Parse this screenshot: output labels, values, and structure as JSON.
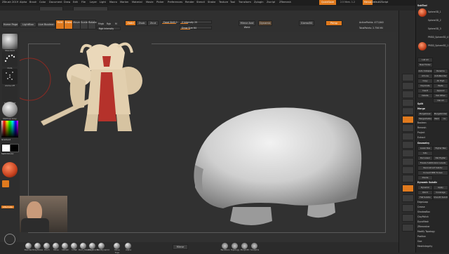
{
  "title": "ZBrush 2019",
  "menu_top": [
    "Alpha",
    "Brush",
    "Color",
    "Document",
    "Draw",
    "Edit",
    "File",
    "Layer",
    "Light",
    "Macro",
    "Marker",
    "Material",
    "Movie",
    "Picker",
    "Preferences",
    "Render",
    "Stencil",
    "Stroke",
    "Texture",
    "Tool",
    "Transform",
    "Zplugin",
    "Zscript",
    "ZRemesh"
  ],
  "quicksave": "QuickSave",
  "default_script": "DefaultZScript",
  "top_right_values": "2.5 Mem. 1.2",
  "shelf": {
    "home_page": "Home Page",
    "lightbox": "LightBox",
    "live_boolean": "Live Boolean",
    "edit": "Edit",
    "draw": "Draw",
    "move": "Move",
    "scale": "Scale",
    "rotate": "Rotate",
    "mrgb": "Mrgb",
    "rgb": "Rgb",
    "m": "M",
    "rgb_intensity": "Rgb Intensity",
    "zadd": "Zadd",
    "zsub": "Zsub",
    "zcut": "Zcut",
    "focal_shift": "Focal Shift 0",
    "draw_size": "Draw Size 64",
    "z_intensity": "Z Intensity 25",
    "dynamic": "Dynamic",
    "mirror_weld": "Mirror And Weld",
    "active_points": "ActivePoints: 473,640",
    "total_points": "TotalPoints: 2.756 Mil",
    "gizmo": "Gizmo3D",
    "persp": "Persp"
  },
  "left_tools": [
    "Standard",
    "Dots",
    "Alpha Off",
    "Texture Off",
    "MatCap Gray"
  ],
  "color_labels": [
    "Gradient",
    "SwitchColor",
    "Alternate"
  ],
  "bottom_brushes": [
    "Standard",
    "ClayTubes",
    "Pinch",
    "Move",
    "hPolish",
    "Inflat",
    "Dam_Standard",
    "Orb_Cracks",
    "TrimDynamic",
    "Move Topo",
    "Alpha"
  ],
  "bottom_mid": "Mirror",
  "bottom_right": [
    "Backface",
    "Topology",
    "Morph3D",
    "Sculptris"
  ],
  "tray": {
    "subtool_header": "SubTool",
    "subtools": [
      "Sphere3D_1",
      "Sphere3D_2",
      "Sphere3D_3",
      "PM3D_Sphere3D_4",
      "PM3D_Sphere3D_1"
    ],
    "list_all": "List All",
    "new_folder": "New Folder",
    "buttons": [
      "Auto Collapse",
      "Rename",
      "AutoReorder",
      "All Low",
      "All High",
      "Copy",
      "Paste",
      "Duplicate",
      "Append",
      "Insert",
      "Del Other",
      "Delete",
      "Del All"
    ],
    "split": "Split",
    "merge": "Merge",
    "merge_items": [
      "MergeDown",
      "MergeSimilar",
      "MergeVisible",
      "Weld",
      "Uv"
    ],
    "boolean": "Boolean",
    "remesh": "Remesh",
    "project": "Project",
    "extract": "Extract",
    "geometry": "Geometry",
    "geometry_items": [
      "Lower Res",
      "Higher Res",
      "Sdiv",
      "Del Lower",
      "Del Higher",
      "Freeze SubDivision Levels",
      "Reconstruct Subdiv",
      "Convert BPR To Geo"
    ],
    "divide": "Divide",
    "dynamic_subdiv": "Dynamic Subdiv",
    "dynamic_items": [
      "Dynamic",
      "Apply",
      "QGrid",
      "Coverage",
      "Flat Subdiv",
      "Smooth Subdiv"
    ],
    "more_items": [
      "EdgeLoop",
      "Crease",
      "ShadowBox",
      "ClayPolish",
      "DynaMesh",
      "ZRemesher",
      "Modify Topology",
      "Position",
      "Size",
      "MeshIntegrity"
    ]
  },
  "colors": {
    "accent": "#e07a1e",
    "armor": "#e8d6b8",
    "cloak": "#b5322b",
    "clay": "#d4d4d4",
    "main_color": "#ffffff",
    "secondary_color": "#000000"
  }
}
